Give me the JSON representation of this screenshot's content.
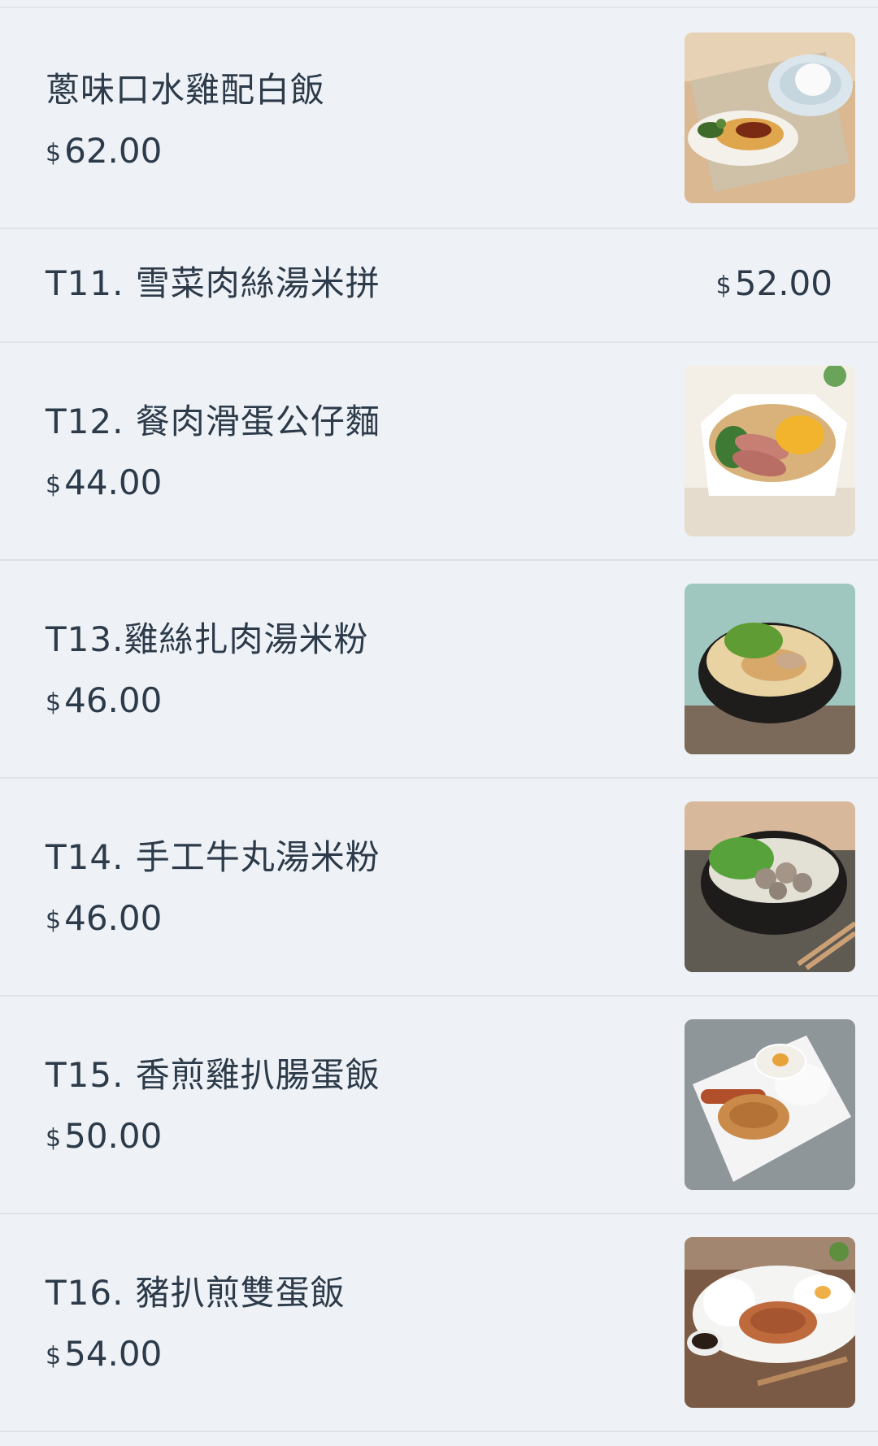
{
  "menu": {
    "items": [
      {
        "name": "蔥味口水雞配白飯",
        "currency": "$",
        "price": "62.00",
        "image": "drool-chicken-rice-photo"
      },
      {
        "name": "T11. 雪菜肉絲湯米拼",
        "currency": "$",
        "price": "52.00",
        "image": null
      },
      {
        "name": "T12. 餐肉滑蛋公仔麵",
        "currency": "$",
        "price": "44.00",
        "image": "luncheon-meat-egg-noodle-photo"
      },
      {
        "name": "T13.雞絲扎肉湯米粉",
        "currency": "$",
        "price": "46.00",
        "image": "chicken-pork-rice-noodle-photo"
      },
      {
        "name": "T14. 手工牛丸湯米粉",
        "currency": "$",
        "price": "46.00",
        "image": "beef-ball-rice-noodle-photo"
      },
      {
        "name": "T15. 香煎雞扒腸蛋飯",
        "currency": "$",
        "price": "50.00",
        "image": "chicken-chop-sausage-egg-rice-photo"
      },
      {
        "name": "T16. 豬扒煎雙蛋飯",
        "currency": "$",
        "price": "54.00",
        "image": "pork-chop-double-egg-rice-photo"
      }
    ]
  }
}
